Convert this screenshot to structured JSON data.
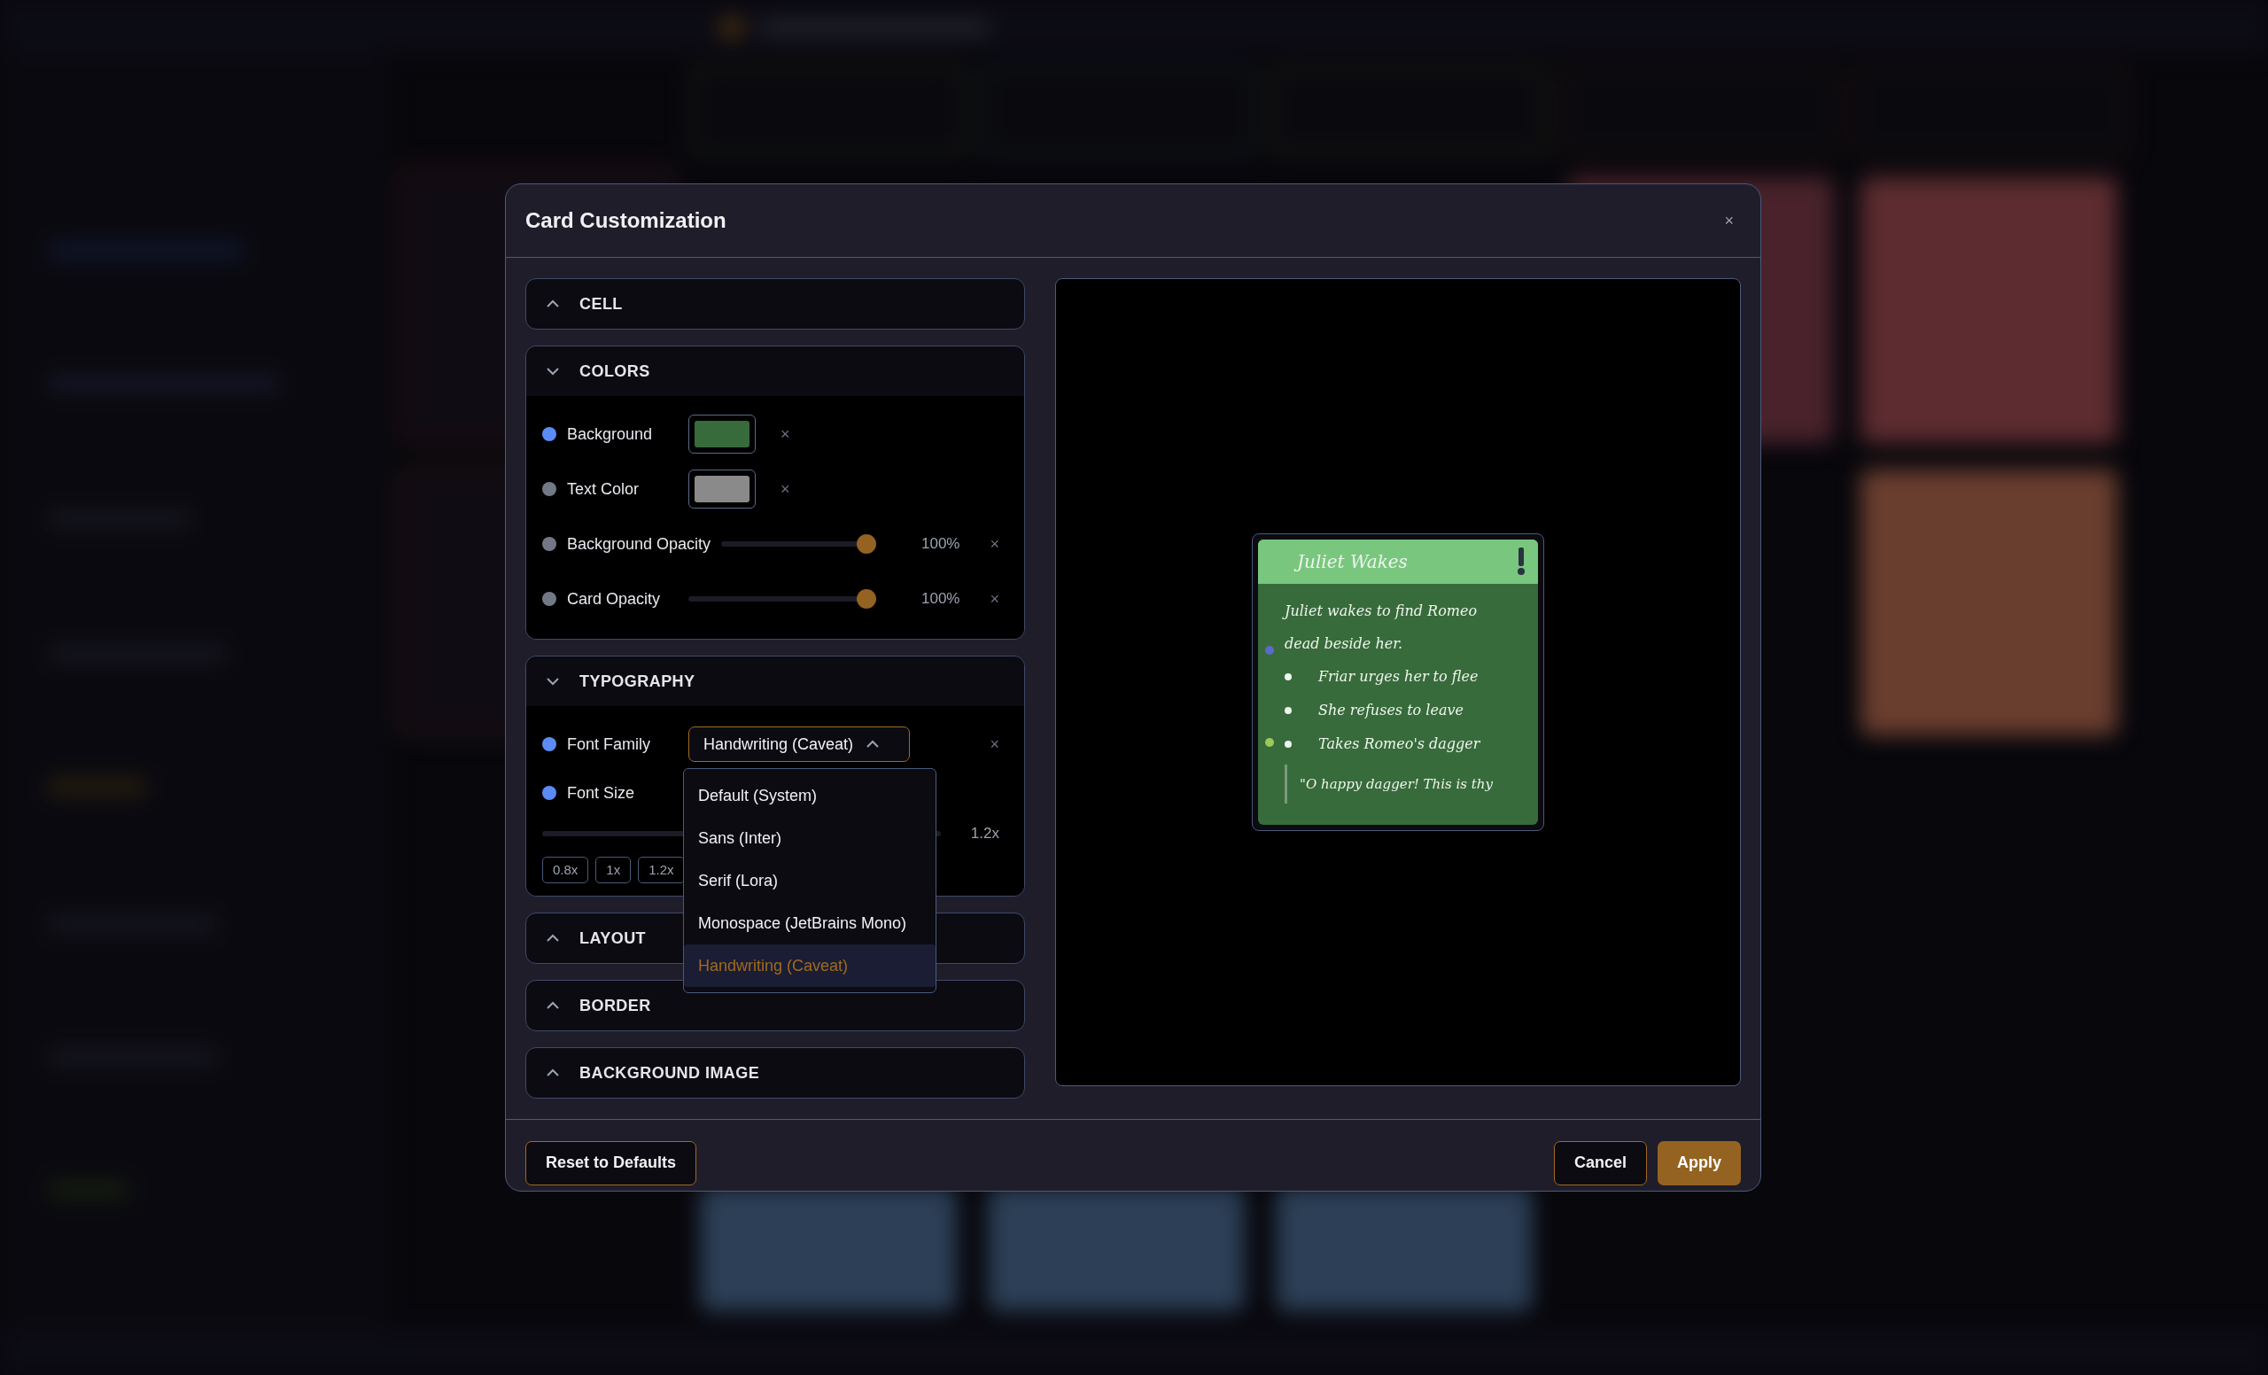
{
  "dialog": {
    "title": "Card Customization",
    "close": "×"
  },
  "sections": [
    {
      "title": "CELL",
      "expanded": false
    },
    {
      "title": "COLORS",
      "expanded": true,
      "rows": [
        {
          "kind": "color",
          "label": "Background",
          "customized": true,
          "color": "#386b3b",
          "clear": "×"
        },
        {
          "kind": "color",
          "label": "Text Color",
          "customized": false,
          "color": "#8a8a8a",
          "clear": "×"
        },
        {
          "kind": "slider",
          "label": "Background Opacity",
          "customized": false,
          "level": 1,
          "reading": "100%",
          "clear": "×"
        },
        {
          "kind": "slider",
          "label": "Card Opacity",
          "customized": false,
          "level": 1,
          "reading": "100%",
          "clear": "×"
        }
      ]
    },
    {
      "title": "TYPOGRAPHY",
      "expanded": true,
      "rows": [
        {
          "kind": "select",
          "label": "Font Family",
          "customized": true,
          "value": "Handwriting (Caveat)",
          "open": true,
          "clear": "×",
          "options": [
            {
              "label": "Default (System)",
              "selected": false
            },
            {
              "label": "Sans (Inter)",
              "selected": false
            },
            {
              "label": "Serif (Lora)",
              "selected": false
            },
            {
              "label": "Monospace (JetBrains Mono)",
              "selected": false
            },
            {
              "label": "Handwriting (Caveat)",
              "selected": true
            }
          ]
        },
        {
          "kind": "size",
          "label": "Font Size",
          "customized": true,
          "reading": "1.2x",
          "presets": [
            "0.8x",
            "1x",
            "1.2x"
          ]
        }
      ]
    },
    {
      "title": "LAYOUT",
      "expanded": false
    },
    {
      "title": "BORDER",
      "expanded": false
    },
    {
      "title": "BACKGROUND IMAGE",
      "expanded": false
    }
  ],
  "preview": {
    "title": "Juliet Wakes",
    "text": "Juliet wakes to find Romeo dead beside her.",
    "bullets": [
      "Friar urges her to flee",
      "She refuses to leave",
      "Takes Romeo's dagger"
    ],
    "quote": "\"O happy dagger! This is thy",
    "markers": [
      {
        "color": "#5b6bc9"
      },
      {
        "color": "#9cc95a"
      }
    ]
  },
  "footer": {
    "reset": "Reset to Defaults",
    "cancel": "Cancel",
    "apply": "Apply"
  }
}
